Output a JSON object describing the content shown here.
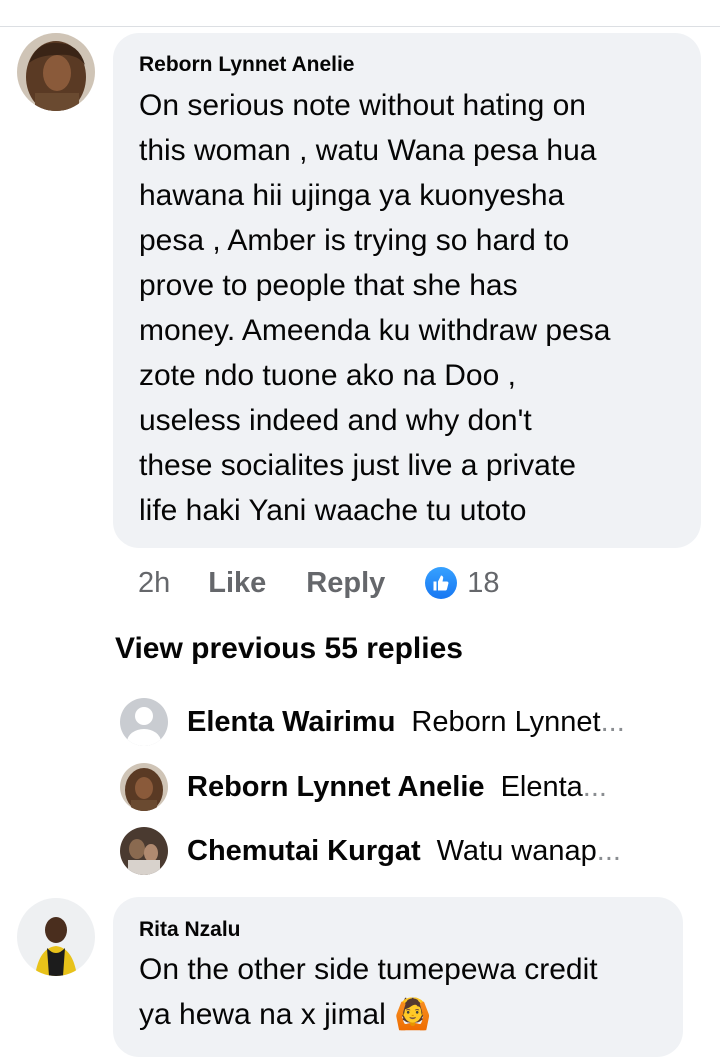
{
  "comments": [
    {
      "author": "Reborn Lynnet Anelie",
      "text": "On serious note without hating on\nthis woman , watu Wana pesa hua\nhawana hii ujinga ya kuonyesha\npesa , Amber is trying so hard to\nprove to people that she has\nmoney. Ameenda ku withdraw pesa\nzote ndo tuone ako na Doo ,\nuseless indeed and  why don't\nthese socialites just live a private\nlife haki Yani waache tu utoto",
      "time": "2h",
      "like_label": "Like",
      "reply_label": "Reply",
      "reaction_icon": "like-icon",
      "reaction_count": "18"
    },
    {
      "author": "Rita Nzalu",
      "text": "On the other side tumepewa credit\nya hewa na x jimal",
      "emoji": "🙆"
    }
  ],
  "replies": {
    "view_previous": "View previous 55 replies",
    "items": [
      {
        "name": "Elenta Wairimu",
        "snippet": "Reborn Lynnet",
        "ellipsis": "...",
        "avatar_icon": "default-profile-icon"
      },
      {
        "name": "Reborn Lynnet Anelie",
        "snippet": "Elenta",
        "ellipsis": "...",
        "avatar_icon": "profile-photo"
      },
      {
        "name": "Chemutai Kurgat",
        "snippet": "Watu wanap",
        "ellipsis": "...",
        "avatar_icon": "profile-photo"
      }
    ]
  },
  "colors": {
    "bubble": "#f0f2f5",
    "meta_gray": "#65676b",
    "like_blue": "#1877f2",
    "text": "#050505"
  }
}
